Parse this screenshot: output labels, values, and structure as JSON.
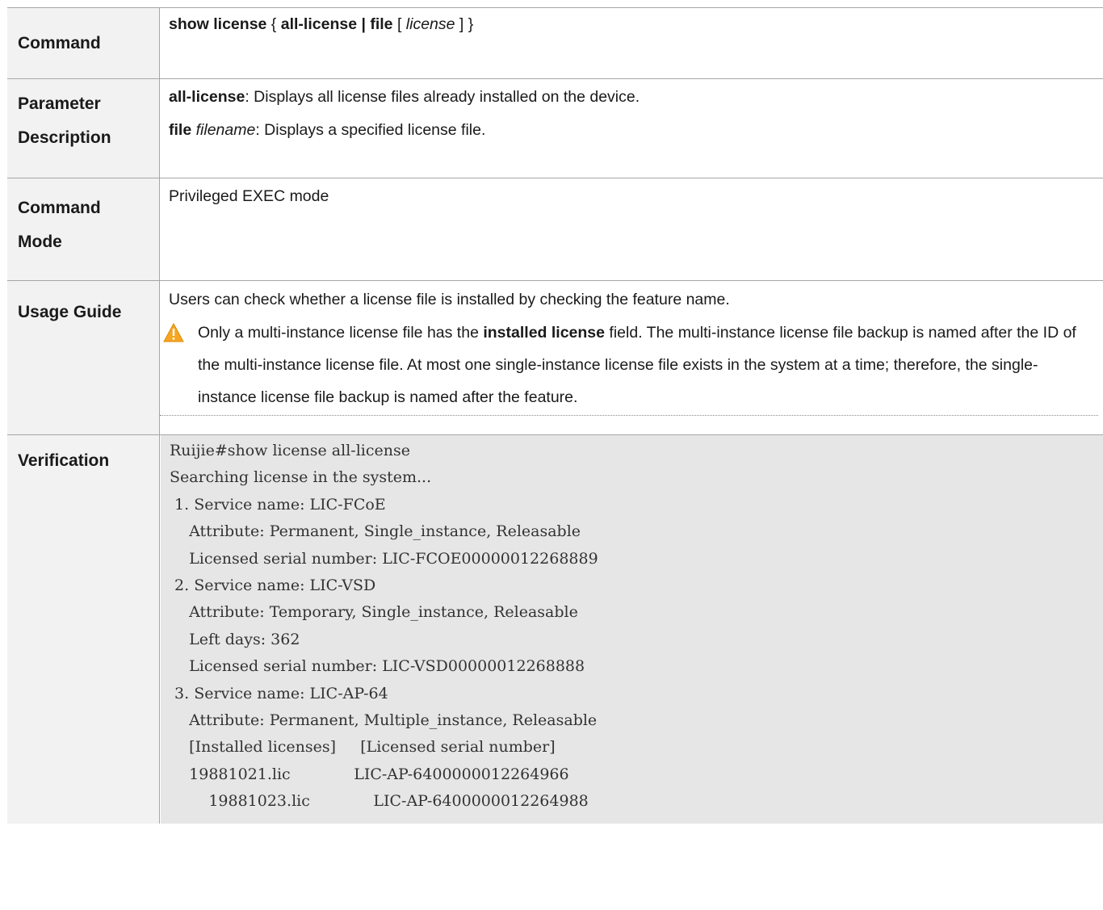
{
  "rows": {
    "command": {
      "label": "Command",
      "syntax": {
        "kw1": "show license",
        "brace_open": " { ",
        "kw2": "all-license | file",
        "bracket_open": " [ ",
        "arg": "license",
        "bracket_close": " ] }"
      }
    },
    "parameter": {
      "label_line1": "Parameter",
      "label_line2": "Description",
      "items": [
        {
          "term": "all-license",
          "arg": "",
          "desc": ": Displays all license files already installed on the device."
        },
        {
          "term": "file",
          "arg": "filename",
          "desc": ": Displays a specified license file."
        }
      ]
    },
    "mode": {
      "label_line1": "Command",
      "label_line2": "Mode",
      "text": "Privileged EXEC mode"
    },
    "usage": {
      "label": "Usage Guide",
      "text": "Users can check whether a license file is installed by checking the feature name.",
      "note": {
        "icon": "warning-icon",
        "before": "Only a multi-instance license file has the ",
        "bold": "installed license",
        "after": " field. The multi-instance license file backup is named after the ID of the multi-instance license file. At most one single-instance license file exists in the system at a time; therefore, the single-instance license file backup is named after the feature."
      }
    },
    "verification": {
      "label": "Verification",
      "lines": [
        "Ruijie#show license all-license",
        "Searching license in the system...",
        " 1. Service name: LIC-FCoE",
        "    Attribute: Permanent, Single_instance, Releasable",
        "    Licensed serial number: LIC-FCOE00000012268889",
        " 2. Service name: LIC-VSD",
        "    Attribute: Temporary, Single_instance, Releasable",
        "    Left days: 362",
        "    Licensed serial number: LIC-VSD00000012268888",
        " 3. Service name: LIC-AP-64",
        "    Attribute: Permanent, Multiple_instance, Releasable",
        "    [Installed licenses]     [Licensed serial number]",
        "    19881021.lic             LIC-AP-6400000012264966",
        "        19881023.lic             LIC-AP-6400000012264988"
      ]
    }
  },
  "colors": {
    "label_bg": "#f2f2f2",
    "code_bg": "#e6e6e6",
    "border": "#a6a6a6",
    "warning_fill": "#f5a623"
  }
}
